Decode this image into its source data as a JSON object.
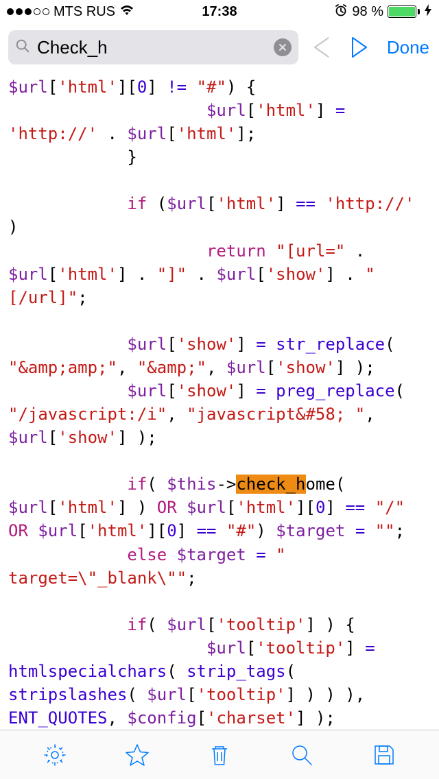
{
  "status": {
    "carrier": "MTS RUS",
    "time": "17:38",
    "battery_percent": "98 %"
  },
  "toolbar": {
    "search_value": "Check_h",
    "done_label": "Done"
  },
  "code": {
    "search_match": "check_h",
    "lines": [
      "$url['html'][0] != \"#\") {",
      "                    $url['html'] = 'http://' . $url['html'];",
      "            }",
      "",
      "            if ($url['html'] == 'http://' )",
      "                    return \"[url=\" . $url['html'] . \"]\" . $url['show'] . \"[/url]\";",
      "",
      "            $url['show'] = str_replace( \"&amp;amp;\", \"&amp;\", $url['show'] );",
      "            $url['show'] = preg_replace( \"/javascript:/i\", \"javascript&#58; \", $url['show'] );",
      "",
      "            if( $this->check_home( $url['html'] ) OR $url['html'][0] == \"/\" OR $url['html'][0] == \"#\") $target = \"\";",
      "            else $target = \" target=\\\"_blank\\\"\";",
      "",
      "            if( $url['tooltip'] ) {",
      "                    $url['tooltip'] = htmlspecialchars( strip_tags( stripslashes( $url['tooltip'] ) ) ), ENT_QUOTES, $config['charset'] );"
    ]
  }
}
